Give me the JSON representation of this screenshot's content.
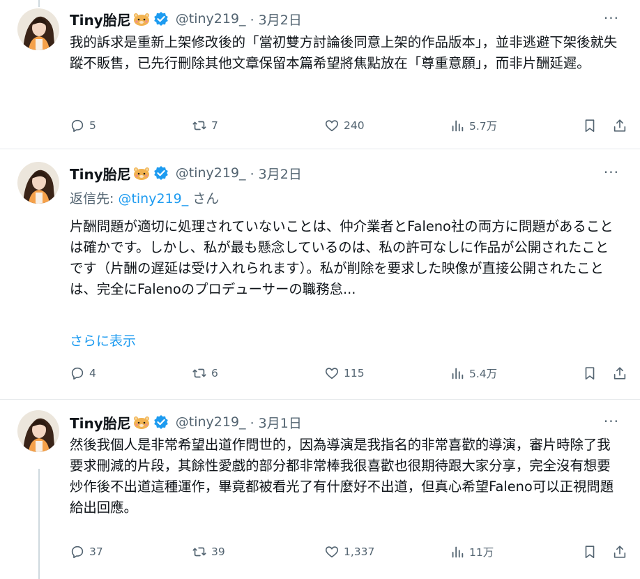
{
  "tweets": [
    {
      "author_name": "Tiny胎尼",
      "handle": "@tiny219_",
      "date": "· 3月2日",
      "more": "···",
      "reply_to_prefix": "",
      "reply_to_handle": "",
      "reply_to_suffix": "",
      "text": "我的訴求是重新上架修改後的「當初雙方討論後同意上架的作品版本」，並非逃避下架後就失蹤不販售，已先行刪除其他文章保留本篇希望將焦點放在「尊重意願」，而非片酬延遲。",
      "show_more": "",
      "replies": "5",
      "retweets": "7",
      "likes": "240",
      "views": "5.7万"
    },
    {
      "author_name": "Tiny胎尼",
      "handle": "@tiny219_",
      "date": "· 3月2日",
      "more": "···",
      "reply_to_prefix": "返信先: ",
      "reply_to_handle": "@tiny219_",
      "reply_to_suffix": "さん",
      "text": "片酬問題が適切に処理されていないことは、仲介業者とFaleno社の両方に問題があることは確かです。しかし、私が最も懸念しているのは、私の許可なしに作品が公開されたことです（片酬の遅延は受け入れられます）。私が削除を要求した映像が直接公開されたことは、完全にFalenoのプロデューサーの職務怠...",
      "show_more": "さらに表示",
      "replies": "4",
      "retweets": "6",
      "likes": "115",
      "views": "5.4万"
    },
    {
      "author_name": "Tiny胎尼",
      "handle": "@tiny219_",
      "date": "· 3月1日",
      "more": "···",
      "reply_to_prefix": "",
      "reply_to_handle": "",
      "reply_to_suffix": "",
      "text": "然後我個人是非常希望出道作問世的，因為導演是我指名的非常喜歡的導演，審片時除了我要求刪減的片段，其餘性愛戲的部分都非常棒我很喜歡也很期待跟大家分享，完全沒有想要炒作後不出道這種運作，畢竟都被看光了有什麼好不出道，但真心希望Faleno可以正視問題給出回應。",
      "show_more": "",
      "replies": "37",
      "retweets": "39",
      "likes": "1,337",
      "views": "11万"
    }
  ],
  "icons": {
    "verified": "verified-badge-icon",
    "emoji": "hamster-emoji-icon",
    "reply": "reply-icon",
    "retweet": "retweet-icon",
    "like": "heart-icon",
    "views": "views-chart-icon",
    "bookmark": "bookmark-icon",
    "share": "share-icon"
  },
  "colors": {
    "accent": "#1d9bf0",
    "text": "#0f1419",
    "secondary": "#536471",
    "divider": "#e6e9ec"
  }
}
